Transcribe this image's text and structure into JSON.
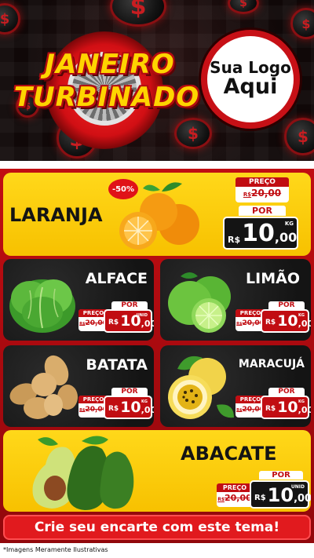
{
  "header": {
    "title_line1": "JANEIRO",
    "title_line2": "TURBINADO",
    "logo_line1": "Sua Logo",
    "logo_line2": "Aqui",
    "coin_symbol": "$"
  },
  "products": {
    "laranja": {
      "name": "LARANJA",
      "discount": "-50%",
      "old_label": "PREÇO",
      "old_currency": "R$",
      "old_price": "20,00",
      "new_label": "POR",
      "currency": "R$",
      "price_int": "10",
      "price_dec": ",00",
      "unit": "KG"
    },
    "alface": {
      "name": "ALFACE",
      "old_label": "PREÇO",
      "old_currency": "R$",
      "old_price": "20,00",
      "new_label": "POR",
      "currency": "R$",
      "price_int": "10",
      "price_dec": ",00",
      "unit": "UNID"
    },
    "limao": {
      "name": "LIMÃO",
      "old_label": "PREÇO",
      "old_currency": "R$",
      "old_price": "20,00",
      "new_label": "POR",
      "currency": "R$",
      "price_int": "10",
      "price_dec": ",00",
      "unit": "KG"
    },
    "batata": {
      "name": "BATATA",
      "old_label": "PREÇO",
      "old_currency": "R$",
      "old_price": "20,00",
      "new_label": "POR",
      "currency": "R$",
      "price_int": "10",
      "price_dec": ",00",
      "unit": "KG"
    },
    "maracuja": {
      "name": "MARACUJÁ",
      "old_label": "PREÇO",
      "old_currency": "R$",
      "old_price": "20,00",
      "new_label": "POR",
      "currency": "R$",
      "price_int": "10",
      "price_dec": ",00",
      "unit": "KG"
    },
    "abacate": {
      "name": "ABACATE",
      "old_label": "PREÇO",
      "old_currency": "R$",
      "old_price": "20,00",
      "new_label": "POR",
      "currency": "R$",
      "price_int": "10",
      "price_dec": ",00",
      "unit": "UNID"
    }
  },
  "footer": {
    "cta": "Crie seu encarte com este tema!",
    "disclaimer": "*Imagens Meramente Ilustrativas"
  },
  "colors": {
    "brand_red": "#c10d12",
    "brand_yellow": "#ffd400",
    "dark_card": "#141414"
  },
  "icons": [
    "coin-dollar-icon",
    "turbo-gear-icon"
  ]
}
